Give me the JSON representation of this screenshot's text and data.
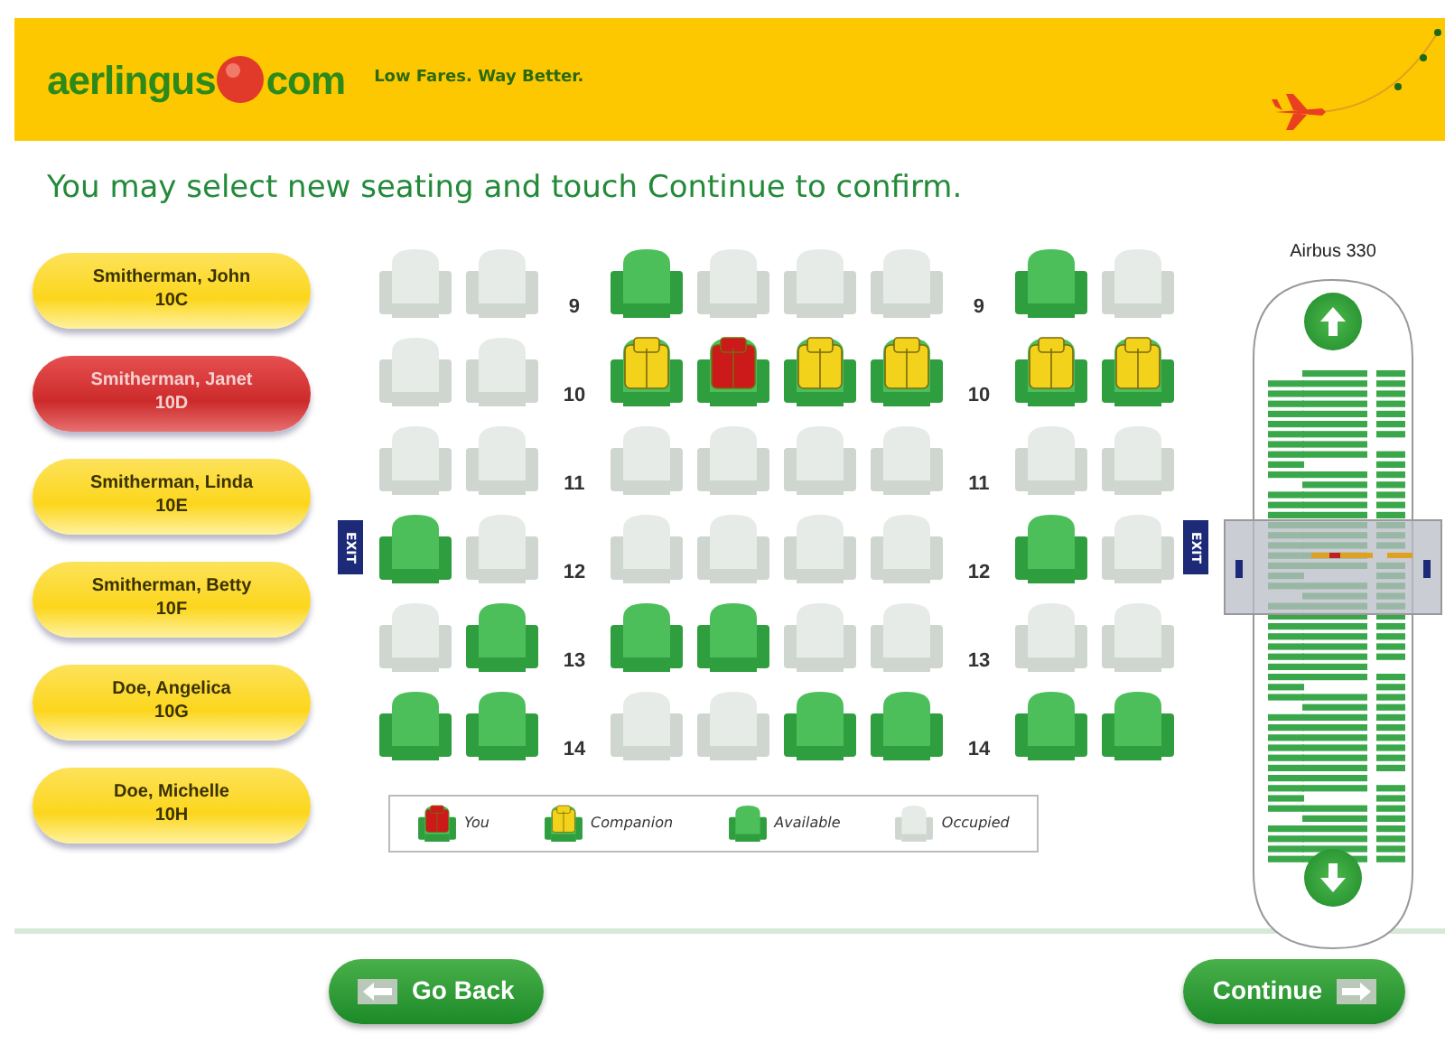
{
  "header": {
    "logo_left": "aerlingus",
    "logo_right": "com",
    "tagline": "Low Fares. Way Better."
  },
  "instruction": "You may select new seating and touch Continue to confirm.",
  "passengers": [
    {
      "name": "Smitherman, John",
      "seat": "10C",
      "selected": false
    },
    {
      "name": "Smitherman, Janet",
      "seat": "10D",
      "selected": true
    },
    {
      "name": "Smitherman, Linda",
      "seat": "10E",
      "selected": false
    },
    {
      "name": "Smitherman, Betty",
      "seat": "10F",
      "selected": false
    },
    {
      "name": "Doe, Angelica",
      "seat": "10G",
      "selected": false
    },
    {
      "name": "Doe, Michelle",
      "seat": "10H",
      "selected": false
    }
  ],
  "seat_rows": [
    {
      "left_label": "9",
      "right_label": "9",
      "seats": [
        {
          "kind": "occupied"
        },
        {
          "kind": "occupied"
        },
        {
          "kind": "available"
        },
        {
          "kind": "occupied"
        },
        {
          "kind": "occupied"
        },
        {
          "kind": "occupied"
        },
        {
          "kind": "available"
        },
        {
          "kind": "occupied"
        }
      ]
    },
    {
      "left_label": "10",
      "right_label": "10",
      "seats": [
        {
          "kind": "occupied"
        },
        {
          "kind": "occupied"
        },
        {
          "kind": "companion"
        },
        {
          "kind": "you"
        },
        {
          "kind": "companion"
        },
        {
          "kind": "companion"
        },
        {
          "kind": "companion"
        },
        {
          "kind": "companion"
        }
      ]
    },
    {
      "left_label": "11",
      "right_label": "11",
      "seats": [
        {
          "kind": "occupied"
        },
        {
          "kind": "occupied"
        },
        {
          "kind": "occupied"
        },
        {
          "kind": "occupied"
        },
        {
          "kind": "occupied"
        },
        {
          "kind": "occupied"
        },
        {
          "kind": "occupied"
        },
        {
          "kind": "occupied"
        }
      ]
    },
    {
      "left_label": "12",
      "right_label": "12",
      "exits": [
        "EXIT",
        "EXIT"
      ],
      "seats": [
        {
          "kind": "available"
        },
        {
          "kind": "occupied"
        },
        {
          "kind": "occupied"
        },
        {
          "kind": "occupied"
        },
        {
          "kind": "occupied"
        },
        {
          "kind": "occupied"
        },
        {
          "kind": "available"
        },
        {
          "kind": "occupied"
        }
      ]
    },
    {
      "left_label": "13",
      "right_label": "13",
      "seats": [
        {
          "kind": "occupied"
        },
        {
          "kind": "available"
        },
        {
          "kind": "available"
        },
        {
          "kind": "available"
        },
        {
          "kind": "occupied"
        },
        {
          "kind": "occupied"
        },
        {
          "kind": "occupied"
        },
        {
          "kind": "occupied"
        }
      ]
    },
    {
      "left_label": "14",
      "right_label": "14",
      "seats": [
        {
          "kind": "available"
        },
        {
          "kind": "available"
        },
        {
          "kind": "occupied"
        },
        {
          "kind": "occupied"
        },
        {
          "kind": "available"
        },
        {
          "kind": "available"
        },
        {
          "kind": "available"
        },
        {
          "kind": "available"
        }
      ]
    }
  ],
  "legend": [
    {
      "kind": "you",
      "label": "You"
    },
    {
      "kind": "companion",
      "label": "Companion"
    },
    {
      "kind": "available",
      "label": "Available"
    },
    {
      "kind": "occupied",
      "label": "Occupied"
    }
  ],
  "aircraft": {
    "title": "Airbus 330"
  },
  "buttons": {
    "back": "Go Back",
    "continue": "Continue"
  }
}
